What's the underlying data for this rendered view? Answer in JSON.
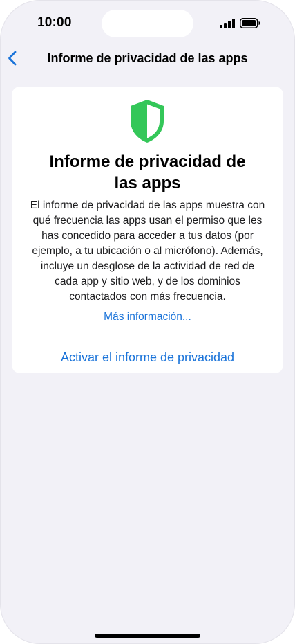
{
  "status_bar": {
    "time": "10:00"
  },
  "nav": {
    "back_icon": "chevron-left-icon",
    "title": "Informe de privacidad de las apps"
  },
  "card": {
    "icon": "shield-icon",
    "title_line1": "Informe de privacidad de",
    "title_line2": "las apps",
    "body_lines": [
      "El informe de privacidad de las apps muestra con",
      "qué frecuencia las apps usan el permiso que les",
      "has concedido para acceder a tus datos (por",
      "ejemplo, a tu ubicación o al micrófono). Además,",
      "incluye un desglose de la actividad de red de",
      "cada app y sitio web, y de los dominios",
      "contactados con más frecuencia."
    ],
    "more_link": "Más información...",
    "activate_button": "Activar el informe de privacidad"
  },
  "colors": {
    "accent": "#1a73d9",
    "shield_green": "#34c759",
    "background": "#f2f1f7"
  }
}
